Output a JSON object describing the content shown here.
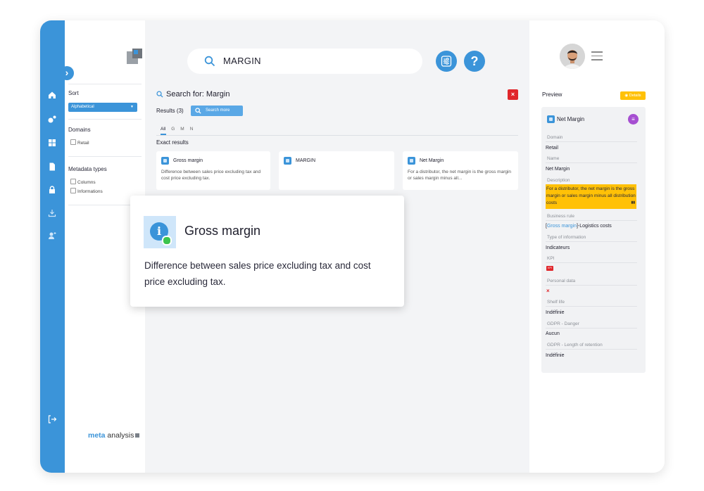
{
  "search": {
    "query": "MARGIN"
  },
  "sidebar": {
    "sort_label": "Sort",
    "sort_value": "Alphabetical",
    "domains_label": "Domains",
    "domains": [
      "Retail"
    ],
    "metadata_label": "Metadata types",
    "metadata": [
      "Columns",
      "Informations"
    ],
    "brand_meta": "meta",
    "brand_rest": " analysis"
  },
  "results": {
    "title": "Search for: Margin",
    "count": "Results (3)",
    "search_more": "Search more",
    "tabs": [
      "All",
      "G",
      "M",
      "N"
    ],
    "active_tab": "All",
    "section": "Exact results",
    "cards": [
      {
        "title": "Gross margin",
        "desc": "Difference between sales price excluding tax and cost price excluding tax."
      },
      {
        "title": "MARGIN",
        "desc": ""
      },
      {
        "title": "Net Margin",
        "desc": "For a distributor, the net margin is the gross margin or sales margin minus all..."
      }
    ]
  },
  "popup": {
    "title": "Gross margin",
    "desc": "Difference between sales price excluding tax and cost price excluding tax."
  },
  "preview": {
    "label": "Preview",
    "details": "Details",
    "title": "Net Margin",
    "domain_label": "Domain",
    "domain_value": "Retail",
    "name_label": "Name",
    "name_value": "Net Margin",
    "desc_label": "Description",
    "desc_value": "For a distributor, the net margin is the gross margin or sales margin minus all distribution costs",
    "rule_label": "Business rule",
    "rule_link": "Gross margin",
    "rule_rest": "]-Logistics costs",
    "type_label": "Type of information",
    "type_value": "Indicateurs",
    "kpi_label": "KPI",
    "kpi_badge": "KPI",
    "personal_label": "Personal data",
    "personal_value": "×",
    "shelf_label": "Shelf life",
    "shelf_value": "Indéfinie",
    "gdpr_danger_label": "GDPR - Danger",
    "gdpr_danger_value": "Aucun",
    "gdpr_retention_label": "GDPR - Length of retention",
    "gdpr_retention_value": "Indéfinie"
  },
  "colors": {
    "accent": "#3b94d9",
    "highlight": "#ffc107",
    "danger": "#e0262b",
    "badge": "#a64fd1"
  }
}
